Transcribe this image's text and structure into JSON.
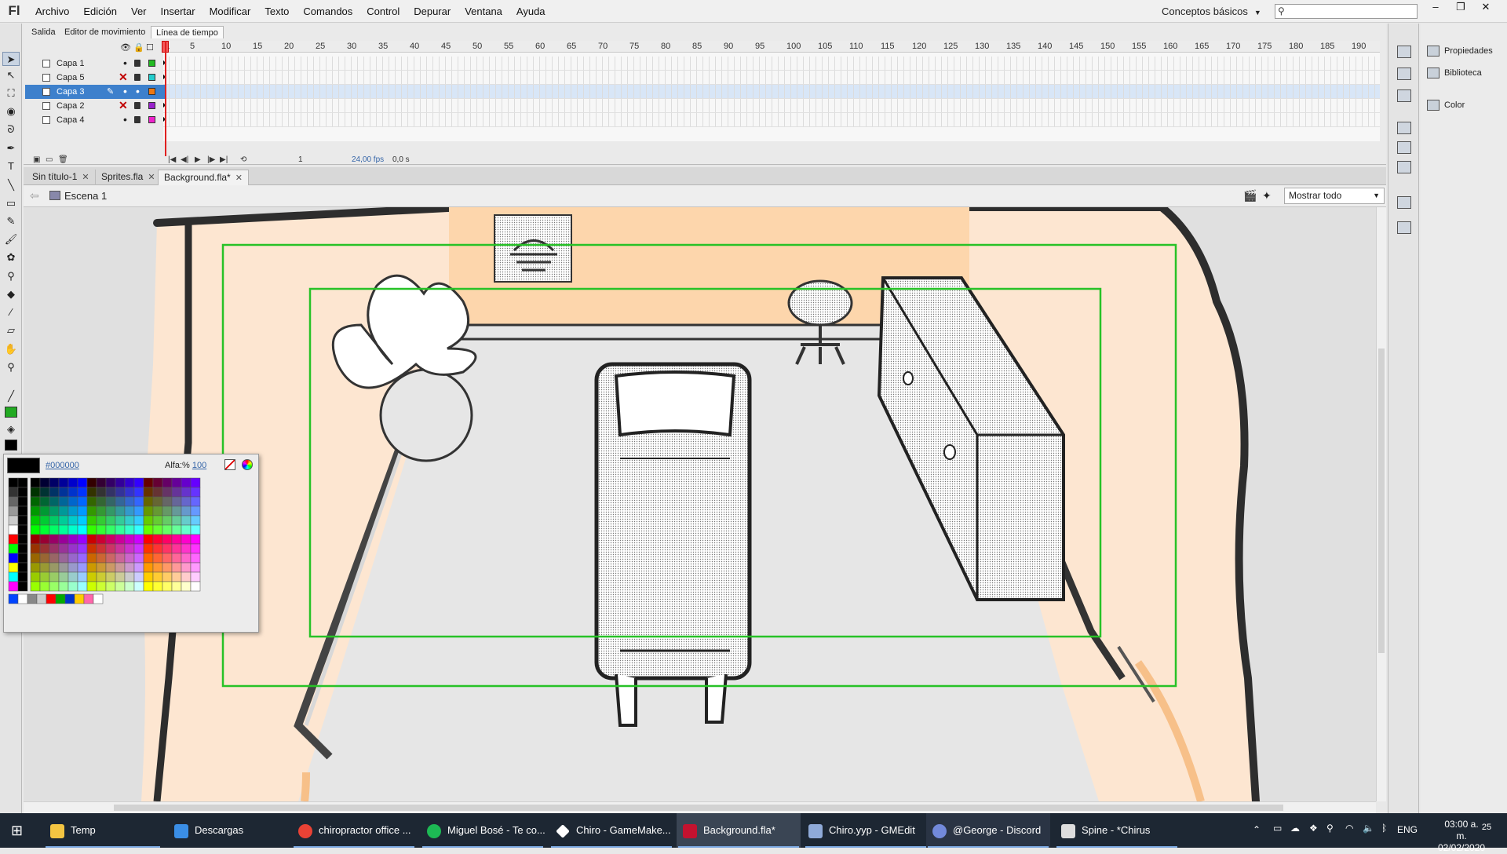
{
  "app": {
    "logo": "Fl",
    "menu": [
      "Archivo",
      "Edición",
      "Ver",
      "Insertar",
      "Modificar",
      "Texto",
      "Comandos",
      "Control",
      "Depurar",
      "Ventana",
      "Ayuda"
    ],
    "workspace": "Conceptos básicos",
    "window_buttons": [
      "–",
      "❐",
      "✕"
    ]
  },
  "panel_tabs": [
    "Salida",
    "Editor de movimiento",
    "Línea de tiempo"
  ],
  "timeline": {
    "ruler": [
      "1",
      "5",
      "10",
      "15",
      "20",
      "25",
      "30",
      "35",
      "40",
      "45",
      "50",
      "55",
      "60",
      "65",
      "70",
      "75",
      "80",
      "85",
      "90",
      "95",
      "100",
      "105",
      "110",
      "115",
      "120",
      "125",
      "130",
      "135",
      "140",
      "145",
      "150",
      "155",
      "160",
      "165",
      "170",
      "175",
      "180",
      "185",
      "190"
    ],
    "layers": [
      {
        "name": "Capa 1",
        "hidden": false,
        "color": "#22bb22",
        "selected": false
      },
      {
        "name": "Capa 5",
        "hidden": true,
        "color": "#22cccc",
        "selected": false
      },
      {
        "name": "Capa 3",
        "hidden": false,
        "color": "#ee7711",
        "selected": true
      },
      {
        "name": "Capa 2",
        "hidden": true,
        "color": "#9922cc",
        "selected": false
      },
      {
        "name": "Capa 4",
        "hidden": false,
        "color": "#ee22cc",
        "selected": false
      }
    ],
    "current_frame": "1",
    "fps": "24,00 fps",
    "time": "0,0 s"
  },
  "doc_tabs": [
    {
      "label": "Sin título-1",
      "active": false
    },
    {
      "label": "Sprites.fla",
      "active": false
    },
    {
      "label": "Background.fla*",
      "active": true
    }
  ],
  "scene": {
    "label": "Escena 1",
    "zoom": "Mostrar todo"
  },
  "swatches": {
    "hex": "#000000",
    "alpha_label": "Alfa:%",
    "alpha_value": "100"
  },
  "right_panel": [
    "Propiedades",
    "Biblioteca",
    "Color"
  ],
  "taskbar": {
    "apps": [
      {
        "label": "Temp",
        "color": "#f4c542"
      },
      {
        "label": "Descargas",
        "color": "#3a8ee6"
      },
      {
        "label": "chiropractor office ...",
        "color": "#e94235"
      },
      {
        "label": "Miguel Bosé - Te co...",
        "color": "#1db954"
      },
      {
        "label": "Chiro - GameMake...",
        "color": "#ffffff"
      },
      {
        "label": "Background.fla*",
        "color": "#c4122f"
      },
      {
        "label": "Chiro.yyp - GMEdit",
        "color": "#8faad8"
      },
      {
        "label": "@George - Discord",
        "color": "#7289da"
      },
      {
        "label": "Spine - *Chirus",
        "color": "#dddddd"
      }
    ],
    "lang": "ENG",
    "time": "03:00 a. m.",
    "date": "02/02/2020",
    "notification_count": "25"
  }
}
